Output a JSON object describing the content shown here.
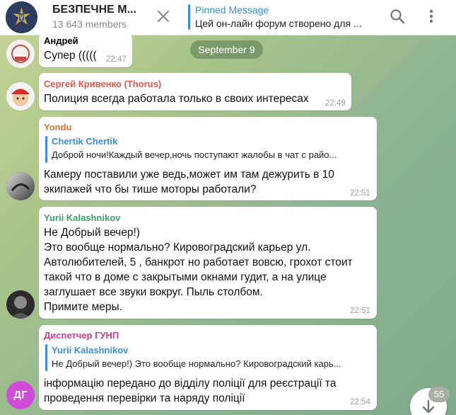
{
  "header": {
    "title": "БЕЗПЕЧНЕ М...",
    "members": "13 643 members",
    "pinned_label": "Pinned Message",
    "pinned_text": "Цей он-лайн форум створено для ..."
  },
  "date_pill": "September 9",
  "messages": [
    {
      "sender": "Андрей",
      "sender_color": "#3a8ee0",
      "lines": [
        "Супер ((((("
      ],
      "time": "22:47"
    },
    {
      "sender": "Сергей Кривенко (Thorus)",
      "sender_color": "#e05a4f",
      "lines": [
        "Полиция всегда работала только в своих интересах"
      ],
      "time": "22:49"
    },
    {
      "sender": "Yondu",
      "sender_color": "#e0742a",
      "reply": {
        "name": "Chertik Chertik",
        "text": "Доброй ночи!Каждый вечер,ночь поступают жалобы в чат с райо..."
      },
      "lines": [
        "Камеру поставили уже ведь,может им там дежурить в 10",
        "экипажей что бы тише моторы работали?"
      ],
      "time": "22:51"
    },
    {
      "sender": "Yurii Kalashnikov",
      "sender_color": "#3aa56a",
      "lines": [
        "Не Добрый вечер!)",
        "Это вообще нормально? Кировоградский карьер ул.",
        "Автолюбителей, 5 , банкрот но работает вовсю, грохот стоит",
        "такой что в доме с закрытыми окнами гудит, а на улице",
        "заглушает все звуки вокруг. Пыль столбом.",
        "Примите меры."
      ],
      "time": "22:51"
    },
    {
      "sender": "Диспетчер ГУНП",
      "sender_color": "#d6378f",
      "reply": {
        "name": "Yurii Kalashnikov",
        "text": "Не Добрый вечер!) Это вообще нормально? Кировоградский карь..."
      },
      "lines": [
        "інформацію передано до відділу поліції для реєстрації та",
        "проведення перевірки та наряду поліції"
      ],
      "time": "22:54"
    }
  ],
  "avatar_initials": "ДГ",
  "unread_count": "55",
  "colors": {
    "accent": "#3a8ee0",
    "initials_avatar": "#d04bd9"
  },
  "icons": [
    "close-icon",
    "search-icon",
    "more-vertical-icon",
    "scroll-down-arrow-icon"
  ]
}
